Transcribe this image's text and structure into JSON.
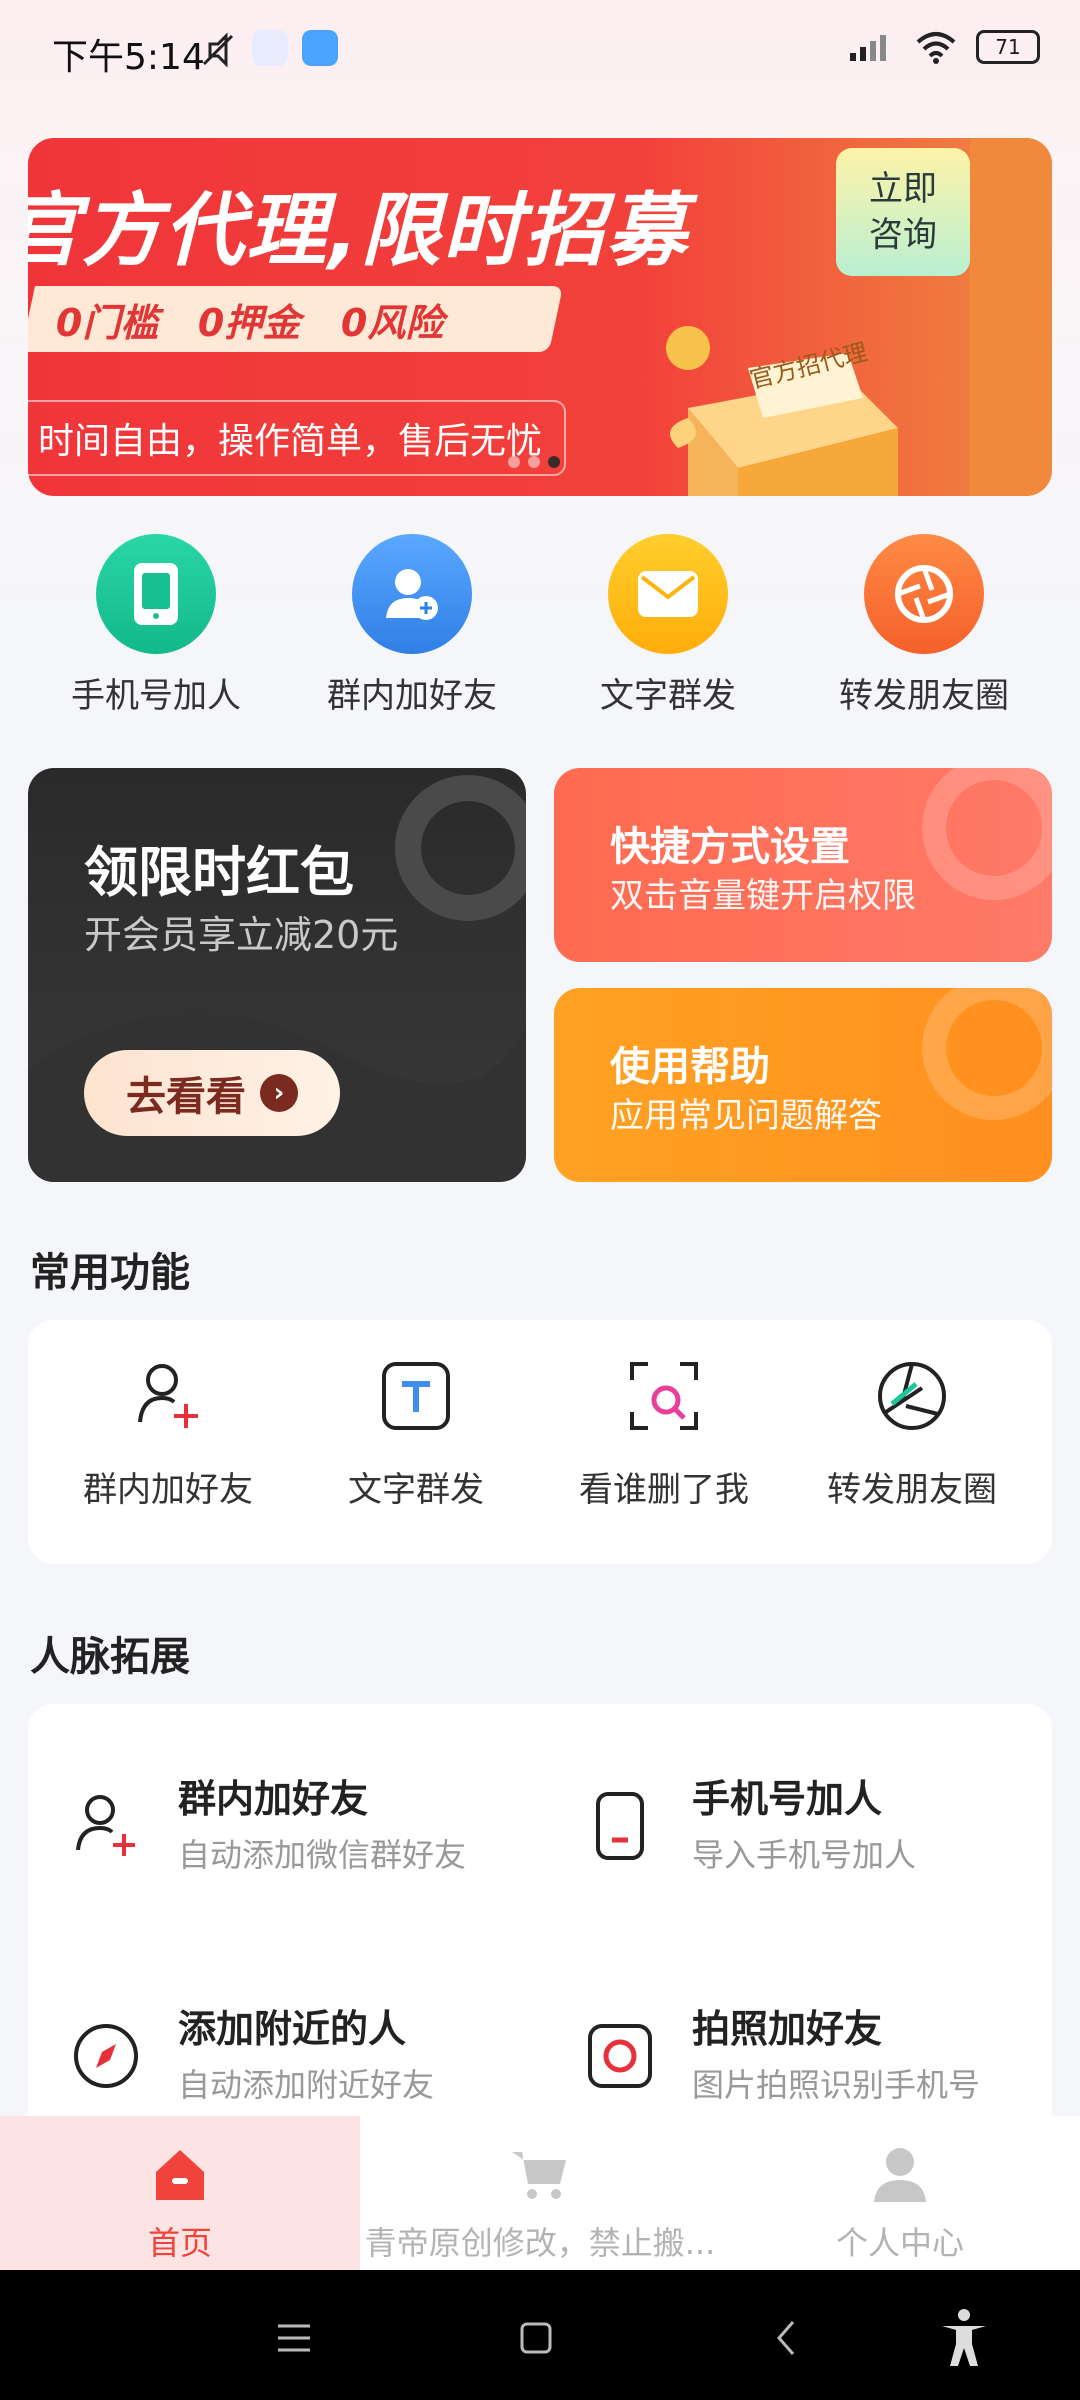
{
  "status_bar": {
    "time": "下午5:14",
    "battery": "71"
  },
  "banner": {
    "title": "官方代理,限时招募",
    "features": [
      "0门槛",
      "0押金",
      "0风险"
    ],
    "subtitle": "时间自由，操作简单，售后无忧",
    "cta_line1": "立即",
    "cta_line2": "咨询",
    "gift_label": "官方招代理"
  },
  "quick_actions": [
    {
      "label": "手机号加人",
      "icon": "phone-icon",
      "color": "#1ec79a"
    },
    {
      "label": "群内加好友",
      "icon": "add-user-icon",
      "color": "#3d8ef0"
    },
    {
      "label": "文字群发",
      "icon": "mail-icon",
      "color": "#ffbd14"
    },
    {
      "label": "转发朋友圈",
      "icon": "aperture-icon",
      "color": "#ff7a35"
    }
  ],
  "promo": {
    "red_packet_title": "领限时红包",
    "red_packet_sub": "开会员享立减20元",
    "red_packet_button": "去看看",
    "shortcut_title": "快捷方式设置",
    "shortcut_sub": "双击音量键开启权限",
    "help_title": "使用帮助",
    "help_sub": "应用常见问题解答"
  },
  "common_section": {
    "title": "常用功能",
    "items": [
      {
        "label": "群内加好友",
        "icon": "add-user-icon"
      },
      {
        "label": "文字群发",
        "icon": "text-icon"
      },
      {
        "label": "看谁删了我",
        "icon": "scan-search-icon"
      },
      {
        "label": "转发朋友圈",
        "icon": "aperture-icon"
      }
    ]
  },
  "network_section": {
    "title": "人脉拓展",
    "items": [
      {
        "title": "群内加好友",
        "sub": "自动添加微信群好友",
        "icon": "add-user-icon"
      },
      {
        "title": "手机号加人",
        "sub": "导入手机号加人",
        "icon": "phone-icon"
      },
      {
        "title": "添加附近的人",
        "sub": "自动添加附近好友",
        "icon": "compass-icon"
      },
      {
        "title": "拍照加好友",
        "sub": "图片拍照识别手机号",
        "icon": "camera-icon"
      }
    ]
  },
  "tabbar": {
    "home": "首页",
    "shop": "青帝原创修改，禁止搬...",
    "profile": "个人中心"
  },
  "colors": {
    "accent": "#f0353a",
    "tab_active_bg": "#fde3e3"
  }
}
